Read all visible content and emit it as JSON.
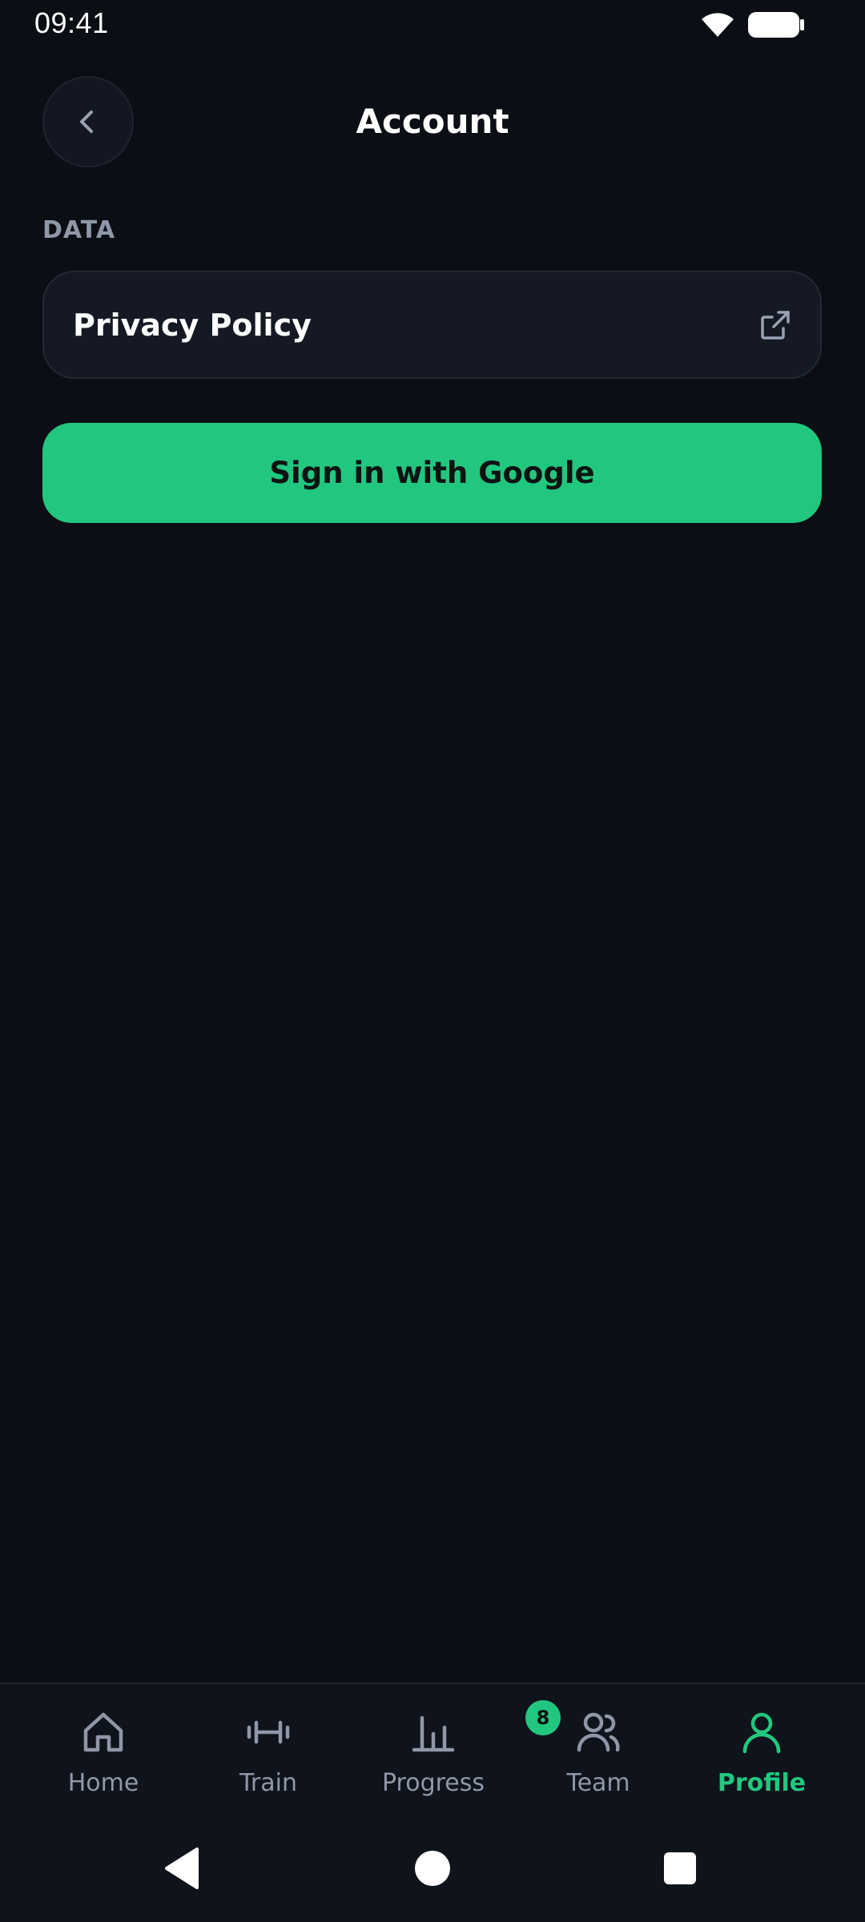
{
  "status_bar": {
    "time": "09:41"
  },
  "header": {
    "title": "Account",
    "back_icon": "chevron-left-icon"
  },
  "section": {
    "label": "DATA"
  },
  "privacy": {
    "label": "Privacy Policy",
    "icon": "external-link-icon"
  },
  "google_button": {
    "label": "Sign in with Google"
  },
  "bottom_nav": {
    "items": [
      {
        "label": "Home",
        "icon": "home-icon",
        "active": false
      },
      {
        "label": "Train",
        "icon": "dumbbell-icon",
        "active": false
      },
      {
        "label": "Progress",
        "icon": "bar-chart-icon",
        "active": false
      },
      {
        "label": "Team",
        "icon": "team-icon",
        "active": false,
        "badge": "8"
      },
      {
        "label": "Profile",
        "icon": "user-icon",
        "active": true
      }
    ]
  },
  "colors": {
    "background": "#0b0e14",
    "accent": "#22c77f",
    "muted": "#8f97a8",
    "card": "#141923"
  }
}
